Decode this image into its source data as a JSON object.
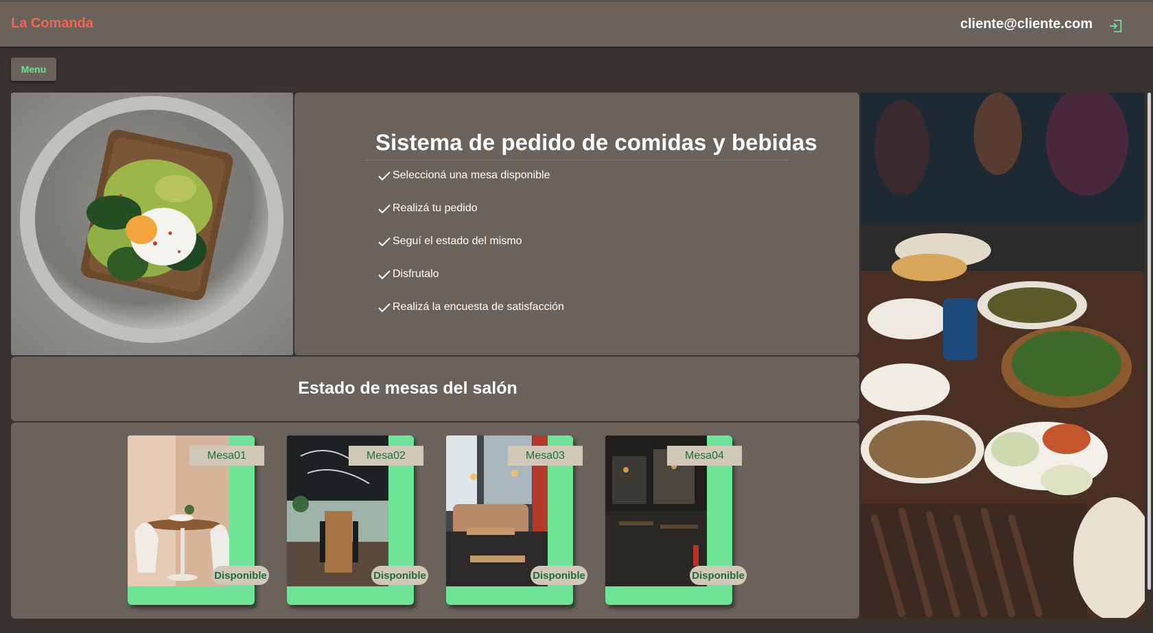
{
  "header": {
    "brand": "La Comanda",
    "user_email": "cliente@cliente.com",
    "logout_icon": "logout-icon"
  },
  "menu_button": {
    "label": "Menu"
  },
  "intro": {
    "title": "Sistema de pedido de comidas y bebidas",
    "steps": [
      "Seleccioná una mesa disponible",
      "Realizá tu pedido",
      "Seguí el estado del mismo",
      "Disfrutalo",
      "Realizá la encuesta de satisfacción"
    ]
  },
  "estado": {
    "title": "Estado de mesas del salón"
  },
  "mesas": [
    {
      "name": "Mesa01",
      "status": "Disponible"
    },
    {
      "name": "Mesa02",
      "status": "Disponible"
    },
    {
      "name": "Mesa03",
      "status": "Disponible"
    },
    {
      "name": "Mesa04",
      "status": "Disponible"
    }
  ],
  "colors": {
    "brand": "#f0664f",
    "accent": "#6ee496",
    "panel": "#6a625b",
    "background": "#38332f",
    "badge": "#d2c8b8",
    "badge_text": "#1e6b3e"
  }
}
